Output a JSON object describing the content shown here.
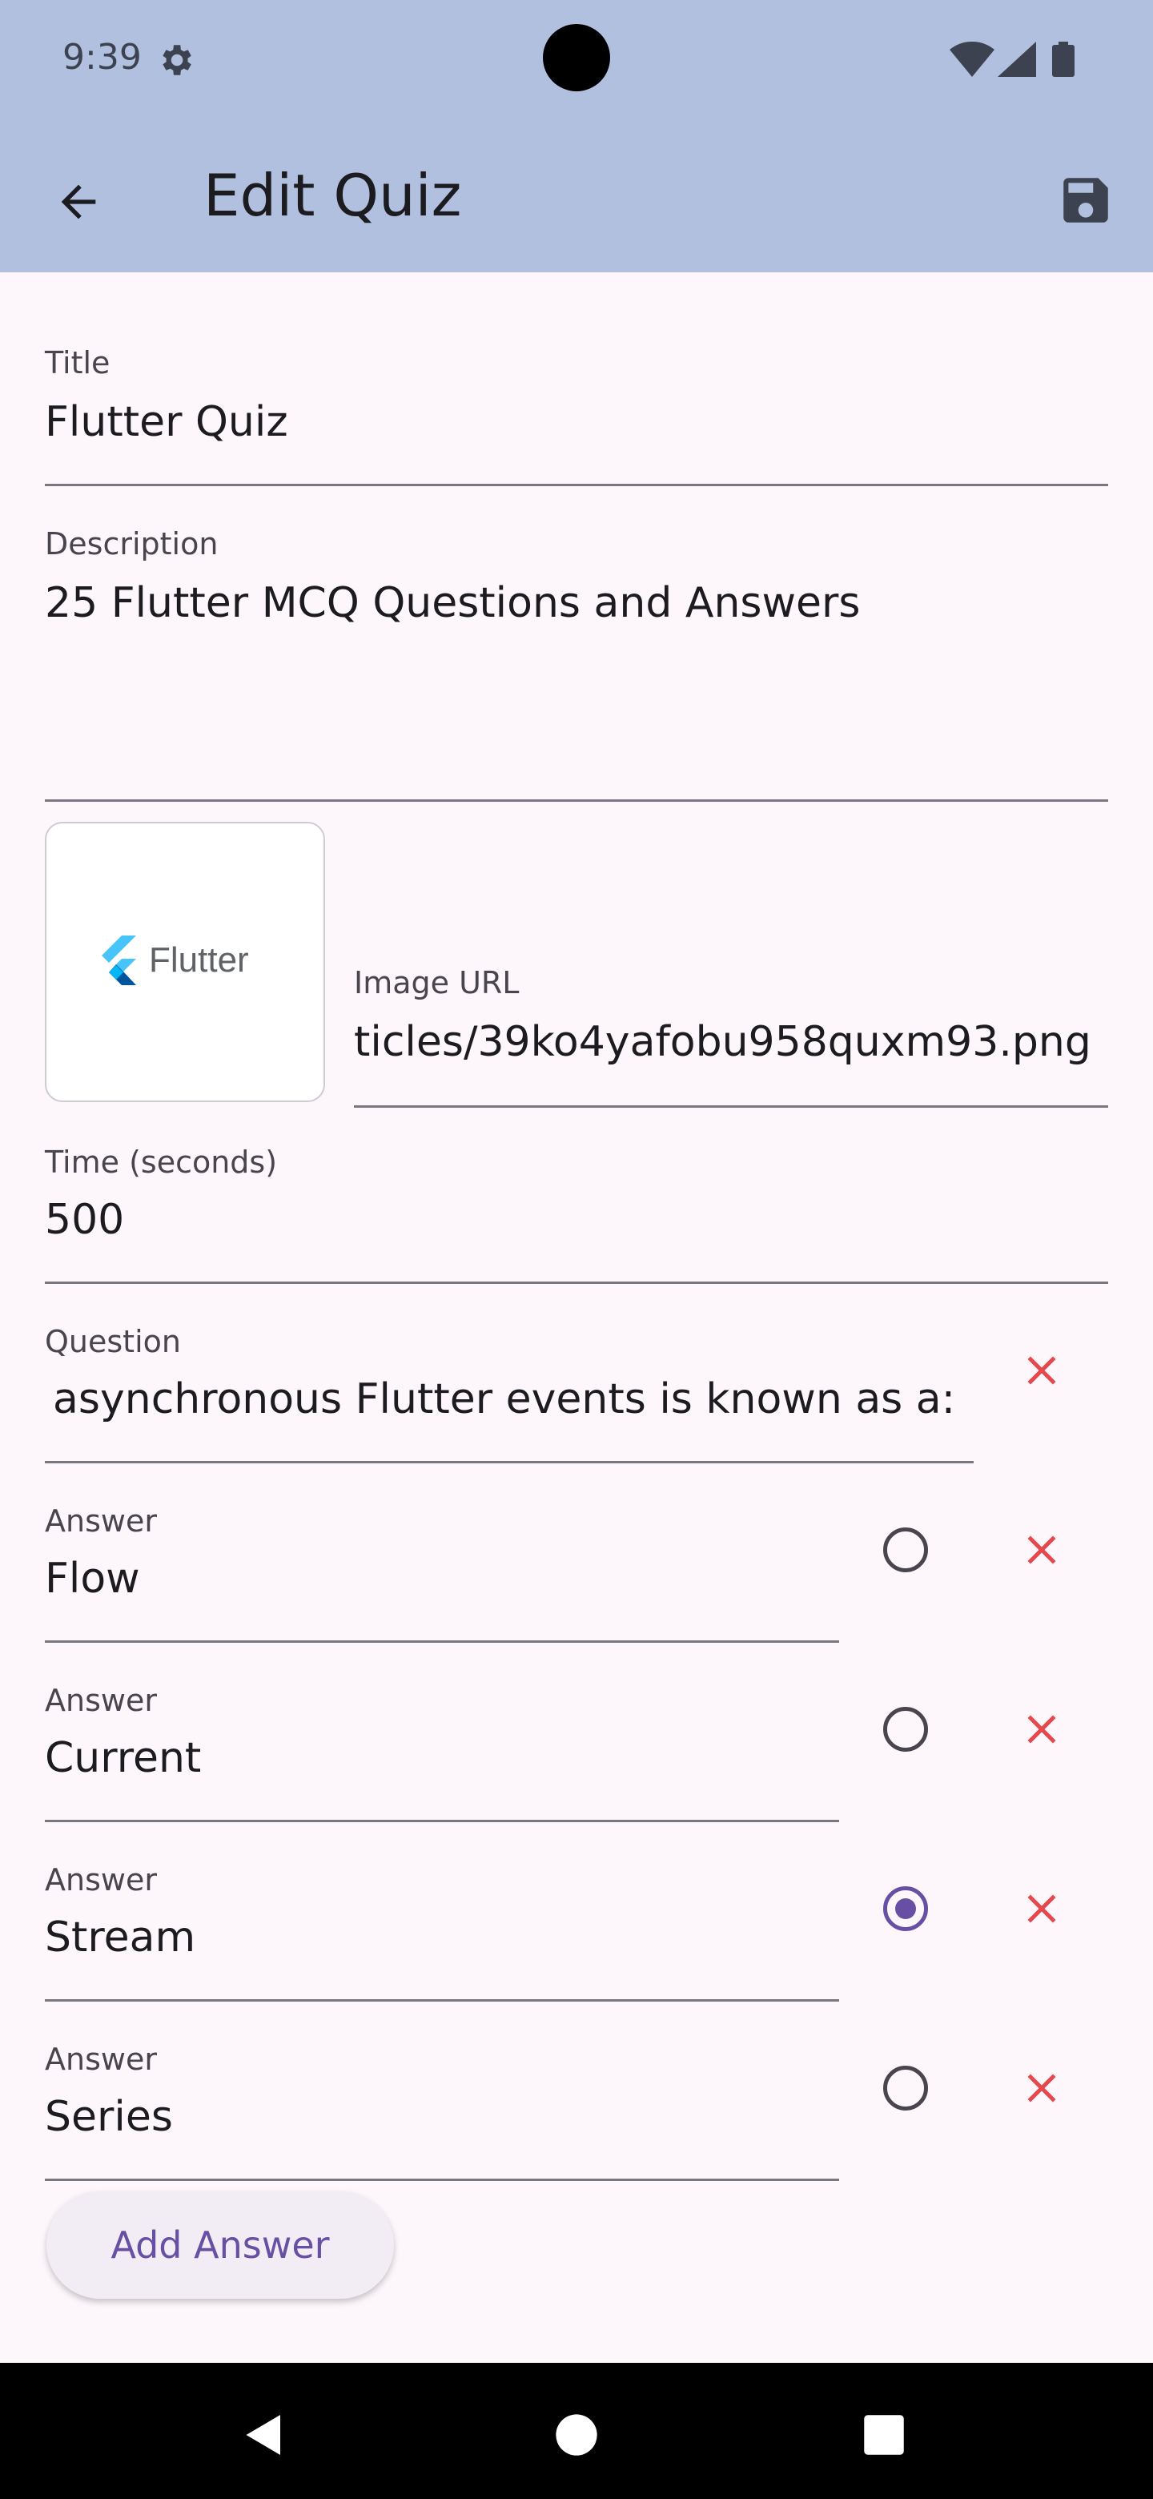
{
  "status_bar": {
    "time": "9:39"
  },
  "app_bar": {
    "title": "Edit Quiz"
  },
  "form": {
    "title_label": "Title",
    "title_value": "Flutter Quiz",
    "description_label": "Description",
    "description_value": "25 Flutter MCQ Questions and Answers",
    "image_preview_text": "Flutter",
    "image_url_label": "Image URL",
    "image_url_value": "ticles/39ko4yafobu958quxm93.png",
    "time_label": "Time (seconds)",
    "time_value": "500",
    "question_label": "Question",
    "question_value": "asynchronous Flutter events is known as a:",
    "answers": [
      {
        "label": "Answer",
        "value": "Flow",
        "selected": false
      },
      {
        "label": "Answer",
        "value": "Current",
        "selected": false
      },
      {
        "label": "Answer",
        "value": "Stream",
        "selected": true
      },
      {
        "label": "Answer",
        "value": "Series",
        "selected": false
      }
    ],
    "add_answer_label": "Add Answer"
  },
  "colors": {
    "header": "#B1C0DF",
    "background": "#FDF7FC",
    "accent": "#6750A4",
    "delete": "#E5484D"
  },
  "icons": {
    "back": "arrow-left",
    "save": "floppy-disk",
    "delete": "close-x",
    "radio": "radio-button"
  }
}
